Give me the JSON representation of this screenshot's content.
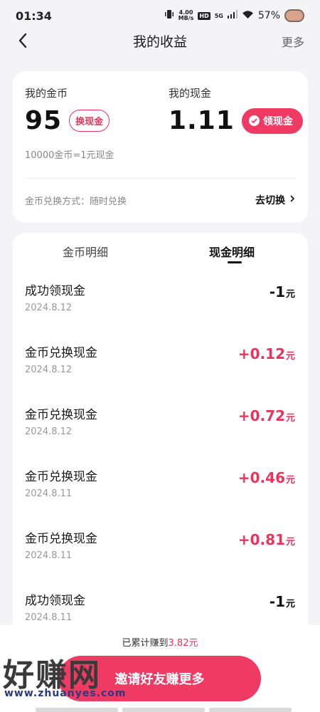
{
  "status_bar": {
    "time": "01:34",
    "net_speed_top": "4.00",
    "net_speed_unit": "MB/s",
    "hd": "HD",
    "network": "5G",
    "battery": "57%"
  },
  "nav": {
    "title": "我的收益",
    "more": "更多"
  },
  "summary": {
    "coin_label": "我的金币",
    "coin_value": "95",
    "exchange_button": "换现金",
    "cash_label": "我的现金",
    "cash_value": "1.11",
    "withdraw_button": "领现金",
    "rate_note": "10000金币=1元现金",
    "exchange_mode": "金币兑换方式：随时兑换",
    "switch_link": "去切换"
  },
  "tabs": {
    "coin_detail": "金币明细",
    "cash_detail": "现金明细",
    "active": "cash_detail"
  },
  "transactions": [
    {
      "title": "成功领现金",
      "date": "2024.8.12",
      "amount": "-1",
      "unit": "元",
      "type": "negative"
    },
    {
      "title": "金币兑换现金",
      "date": "2024.8.12",
      "amount": "+0.12",
      "unit": "元",
      "type": "positive"
    },
    {
      "title": "金币兑换现金",
      "date": "2024.8.12",
      "amount": "+0.72",
      "unit": "元",
      "type": "positive"
    },
    {
      "title": "金币兑换现金",
      "date": "2024.8.11",
      "amount": "+0.46",
      "unit": "元",
      "type": "positive"
    },
    {
      "title": "金币兑换现金",
      "date": "2024.8.11",
      "amount": "+0.81",
      "unit": "元",
      "type": "positive"
    },
    {
      "title": "成功领现金",
      "date": "2024.8.11",
      "amount": "-1",
      "unit": "元",
      "type": "negative"
    }
  ],
  "footer": {
    "total_prefix": "已累计赚到",
    "total_value": "3.82元",
    "invite_button": "邀请好友赚更多"
  },
  "watermark": {
    "logo": "好赚网",
    "url": "www.zhuanyes.com"
  },
  "colors": {
    "accent": "#ef3b64",
    "positive_amount": "#e8345c",
    "negative_amount": "#111111"
  }
}
